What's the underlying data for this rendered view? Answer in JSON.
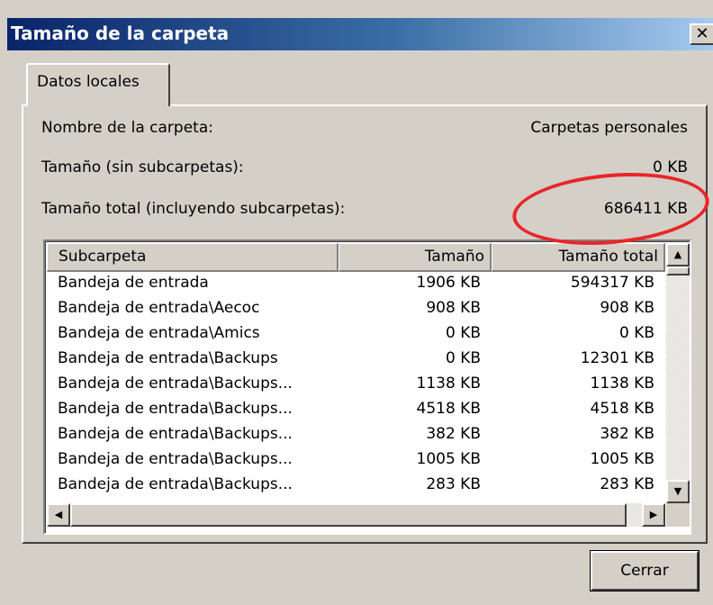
{
  "window": {
    "title": "Tamaño de la carpeta",
    "close_glyph": "✕"
  },
  "tabs": [
    {
      "label": "Datos locales",
      "selected": true
    }
  ],
  "info": {
    "folder_name_label": "Nombre de la carpeta:",
    "folder_name_value": "Carpetas personales",
    "size_label": "Tamaño (sin subcarpetas):",
    "size_value": "0 KB",
    "total_size_label": "Tamaño total (incluyendo subcarpetas):",
    "total_size_value": "686411 KB",
    "highlight_color": "#e8262a"
  },
  "list": {
    "columns": [
      "Subcarpeta",
      "Tamaño",
      "Tamaño total"
    ],
    "rows": [
      [
        "Bandeja de entrada",
        "1906 KB",
        "594317 KB"
      ],
      [
        "Bandeja de entrada\\Aecoc",
        "908 KB",
        "908 KB"
      ],
      [
        "Bandeja de entrada\\Amics",
        "0 KB",
        "0 KB"
      ],
      [
        "Bandeja de entrada\\Backups",
        "0 KB",
        "12301 KB"
      ],
      [
        "Bandeja de entrada\\Backups...",
        "1138 KB",
        "1138 KB"
      ],
      [
        "Bandeja de entrada\\Backups...",
        "4518 KB",
        "4518 KB"
      ],
      [
        "Bandeja de entrada\\Backups...",
        "382 KB",
        "382 KB"
      ],
      [
        "Bandeja de entrada\\Backups...",
        "1005 KB",
        "1005 KB"
      ],
      [
        "Bandeja de entrada\\Backups...",
        "283 KB",
        "283 KB"
      ]
    ]
  },
  "scroll_icons": {
    "up": "▲",
    "down": "▼",
    "left": "◀",
    "right": "▶"
  },
  "buttons": {
    "close_label": "Cerrar"
  }
}
